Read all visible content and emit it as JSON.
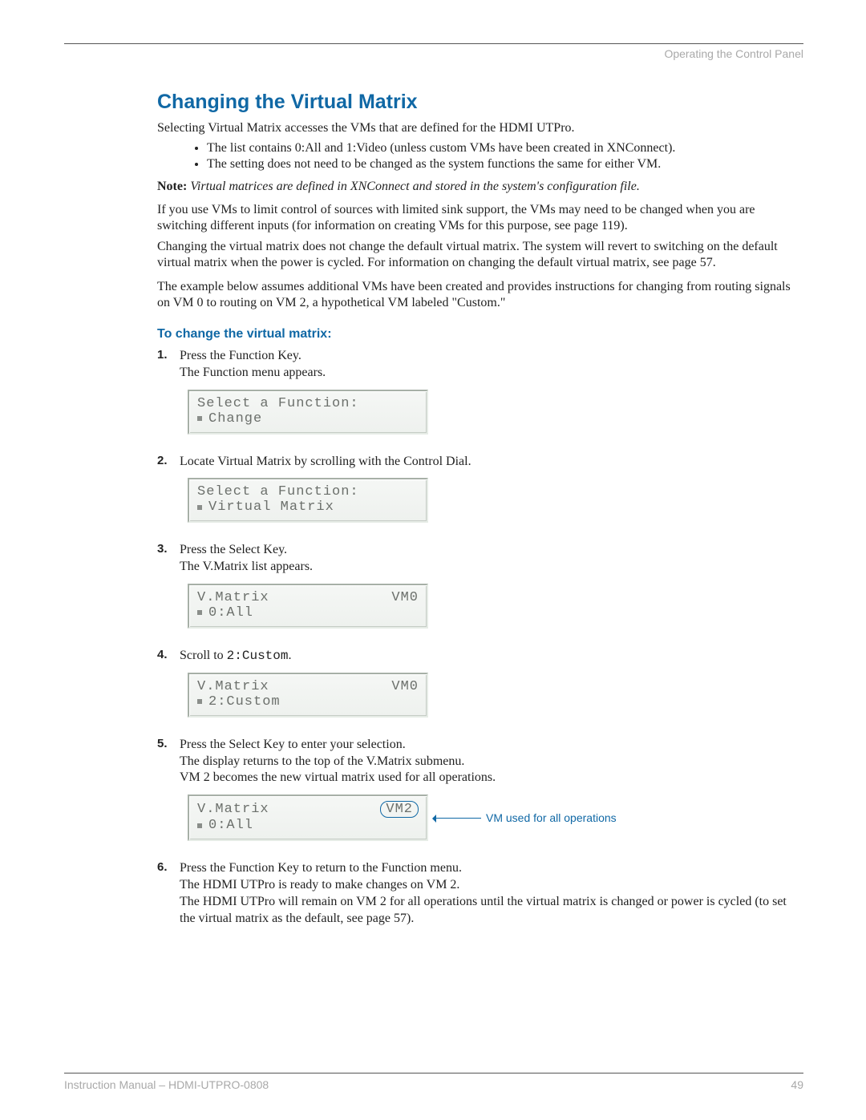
{
  "header": {
    "right": "Operating the Control Panel"
  },
  "title": "Changing the Virtual Matrix",
  "intro": "Selecting Virtual Matrix accesses the VMs that are defined for the HDMI UTPro.",
  "bullets": [
    "The list contains 0:All and 1:Video (unless custom VMs have been created in XNConnect).",
    "The setting does not need to be changed as the system functions the same for either VM."
  ],
  "note": {
    "label": "Note:",
    "body": "Virtual matrices are defined in XNConnect and stored in the system's configuration file."
  },
  "para2": "If you use VMs to limit control of sources with limited sink support, the VMs may need to be changed when you are switching different inputs (for information on creating VMs for this purpose, see page 119).",
  "para3": "Changing the virtual matrix does not change the default virtual matrix. The system will revert to switching on the default virtual matrix when the power is cycled. For information on changing the default virtual matrix, see page 57.",
  "para4": "The example below assumes additional VMs have been created and provides instructions for changing from routing signals on VM 0 to routing on VM 2, a hypothetical VM labeled \"Custom.\"",
  "subhead": "To change the virtual matrix:",
  "steps": [
    {
      "num": "1.",
      "lines": [
        "Press the Function Key.",
        "The Function menu appears."
      ],
      "lcd": {
        "line1": "Select a Function:",
        "line2": "Change"
      }
    },
    {
      "num": "2.",
      "lines": [
        "Locate Virtual Matrix by scrolling with the Control Dial."
      ],
      "lcd": {
        "line1": "Select a Function:",
        "line2": "Virtual Matrix"
      }
    },
    {
      "num": "3.",
      "lines": [
        "Press the Select Key.",
        "The V.Matrix list appears."
      ],
      "lcd": {
        "line1_left": "V.Matrix",
        "line1_right": "VM0",
        "line2": "0:All"
      }
    },
    {
      "num": "4.",
      "lines_rich": {
        "prefix": "Scroll to ",
        "mono": "2:Custom",
        "suffix": "."
      },
      "lcd": {
        "line1_left": "V.Matrix",
        "line1_right": "VM0",
        "line2": "2:Custom"
      }
    },
    {
      "num": "5.",
      "lines": [
        "Press the Select Key to enter your selection.",
        "The display returns to the top of the V.Matrix submenu.",
        "VM 2 becomes the new virtual matrix used for all operations."
      ],
      "lcd": {
        "line1_left": "V.Matrix",
        "line1_pill": "VM2",
        "line2": "0:All"
      },
      "annot": "VM used for all operations"
    },
    {
      "num": "6.",
      "lines": [
        "Press the Function Key to return to the Function menu.",
        "The HDMI UTPro is ready to make changes on VM 2.",
        "The HDMI UTPro will remain on VM 2 for all operations until the virtual matrix is changed or power is cycled (to set the virtual matrix as the default, see page 57)."
      ]
    }
  ],
  "footer": {
    "left": "Instruction Manual – HDMI-UTPRO-0808",
    "right": "49"
  }
}
